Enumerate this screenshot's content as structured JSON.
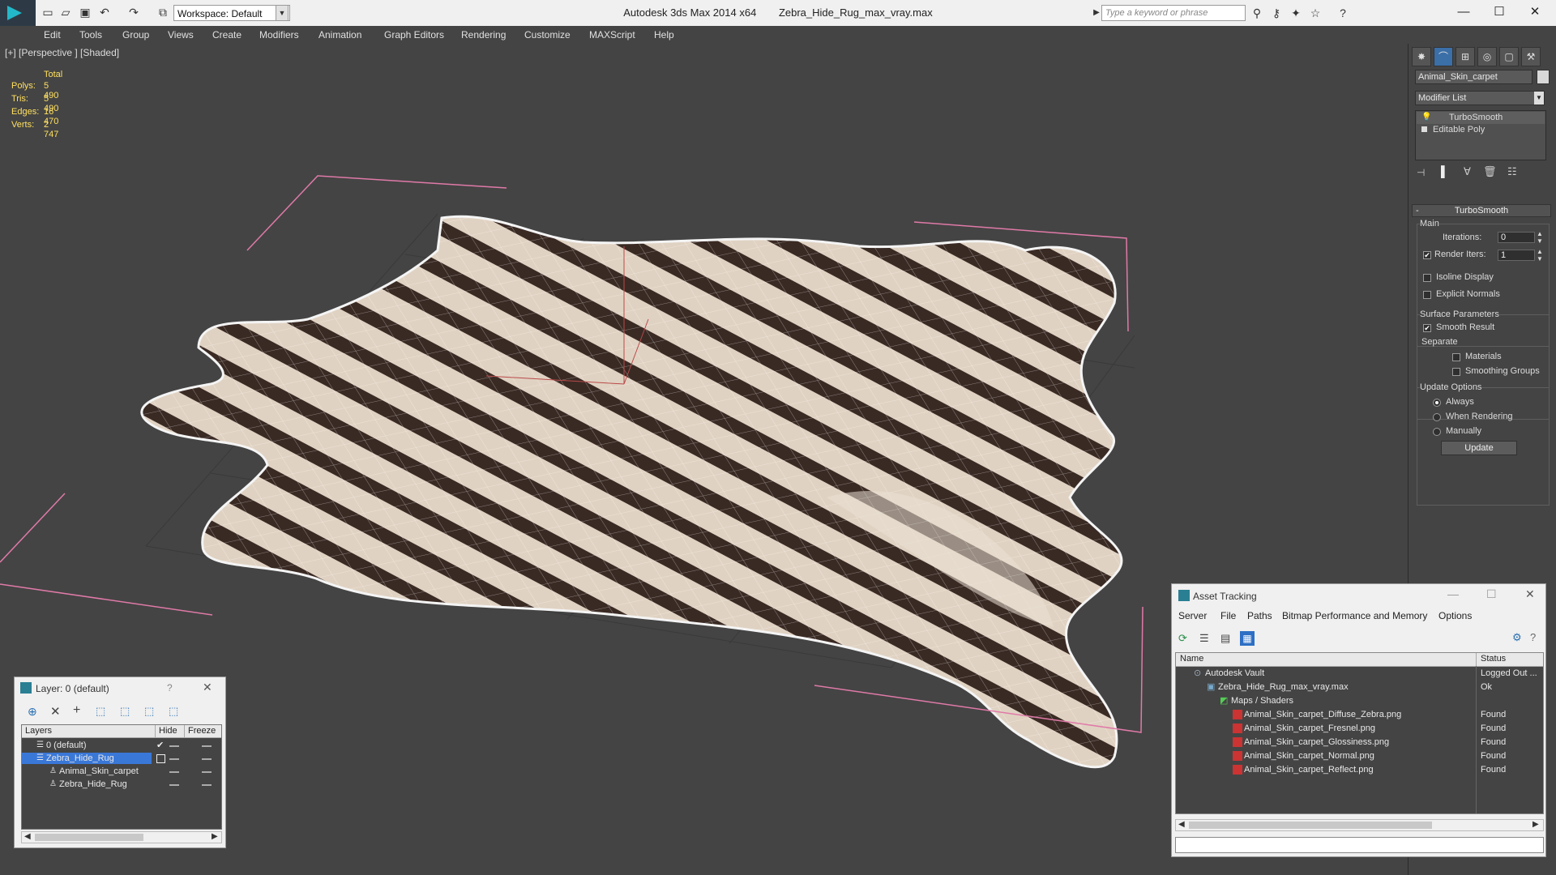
{
  "window": {
    "app_title": "Autodesk 3ds Max  2014 x64",
    "file_title": "Zebra_Hide_Rug_max_vray.max",
    "workspace": "Workspace: Default",
    "search_placeholder": "Type a keyword or phrase"
  },
  "menu": [
    "Edit",
    "Tools",
    "Group",
    "Views",
    "Create",
    "Modifiers",
    "Animation",
    "Graph Editors",
    "Rendering",
    "Customize",
    "MAXScript",
    "Help"
  ],
  "viewport": {
    "label": "[+] [Perspective ] [Shaded]",
    "stats": {
      "header": "Total",
      "rows": [
        {
          "k": "Polys:",
          "v": "5 490"
        },
        {
          "k": "Tris:",
          "v": "5 490"
        },
        {
          "k": "Edges:",
          "v": "16 470"
        },
        {
          "k": "Verts:",
          "v": "2 747"
        }
      ]
    }
  },
  "command_panel": {
    "object_name": "Animal_Skin_carpet",
    "modifier_list": "Modifier List",
    "stack": [
      "TurboSmooth",
      "Editable Poly"
    ],
    "rollout_title": "TurboSmooth",
    "main_label": "Main",
    "iterations_label": "Iterations:",
    "iterations_value": "0",
    "render_iters_label": "Render Iters:",
    "render_iters_value": "1",
    "isoline_label": "Isoline Display",
    "explicit_normals_label": "Explicit Normals",
    "surface_params_label": "Surface Parameters",
    "smooth_result_label": "Smooth Result",
    "separate_label": "Separate",
    "materials_label": "Materials",
    "smoothing_groups_label": "Smoothing Groups",
    "update_options_label": "Update Options",
    "always_label": "Always",
    "when_rendering_label": "When Rendering",
    "manually_label": "Manually",
    "update_button": "Update"
  },
  "layer_window": {
    "title": "Layer: 0 (default)",
    "help": "?",
    "columns": {
      "layers": "Layers",
      "hide": "Hide",
      "freeze": "Freeze"
    },
    "rows": [
      {
        "name": "0 (default)",
        "indent": 0
      },
      {
        "name": "Zebra_Hide_Rug",
        "indent": 0,
        "selected": true
      },
      {
        "name": "Animal_Skin_carpet",
        "indent": 1
      },
      {
        "name": "Zebra_Hide_Rug",
        "indent": 1
      }
    ]
  },
  "asset_window": {
    "title": "Asset Tracking",
    "menu": [
      "Server",
      "File",
      "Paths",
      "Bitmap Performance and Memory",
      "Options"
    ],
    "columns": {
      "name": "Name",
      "status": "Status"
    },
    "rows": [
      {
        "name": "Autodesk Vault",
        "status": "Logged Out ...",
        "indent": 0
      },
      {
        "name": "Zebra_Hide_Rug_max_vray.max",
        "status": "Ok",
        "indent": 1
      },
      {
        "name": "Maps / Shaders",
        "status": "",
        "indent": 2
      },
      {
        "name": "Animal_Skin_carpet_Diffuse_Zebra.png",
        "status": "Found",
        "indent": 3
      },
      {
        "name": "Animal_Skin_carpet_Fresnel.png",
        "status": "Found",
        "indent": 3
      },
      {
        "name": "Animal_Skin_carpet_Glossiness.png",
        "status": "Found",
        "indent": 3
      },
      {
        "name": "Animal_Skin_carpet_Normal.png",
        "status": "Found",
        "indent": 3
      },
      {
        "name": "Animal_Skin_carpet_Reflect.png",
        "status": "Found",
        "indent": 3
      }
    ]
  },
  "colors": {
    "accent": "#2d8fd6",
    "stat_yellow": "#ffe060",
    "selection": "#3a78d8"
  }
}
